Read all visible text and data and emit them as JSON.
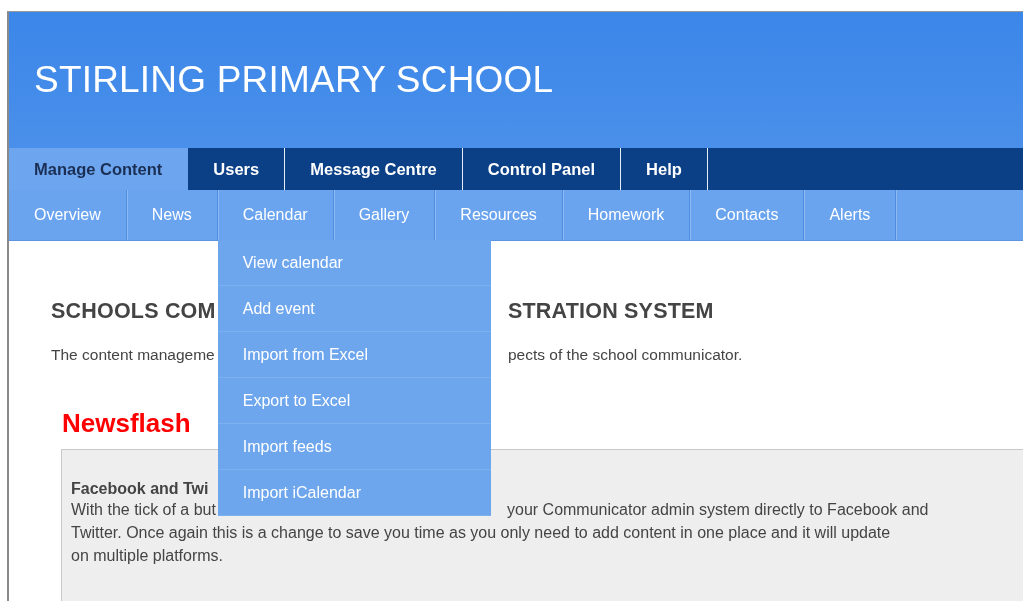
{
  "site_title": "STIRLING PRIMARY SCHOOL",
  "main_nav": [
    {
      "label": "Manage Content",
      "selected": true
    },
    {
      "label": "Users",
      "selected": false
    },
    {
      "label": "Message Centre",
      "selected": false
    },
    {
      "label": "Control Panel",
      "selected": false
    },
    {
      "label": "Help",
      "selected": false
    }
  ],
  "sub_nav": [
    {
      "label": "Overview"
    },
    {
      "label": "News"
    },
    {
      "label": "Calendar",
      "menu": [
        "View calendar",
        "Add event",
        "Import from Excel",
        "Export to Excel",
        "Import feeds",
        "Import iCalendar"
      ]
    },
    {
      "label": "Gallery"
    },
    {
      "label": "Resources"
    },
    {
      "label": "Homework"
    },
    {
      "label": "Contacts"
    },
    {
      "label": "Alerts"
    }
  ],
  "heading": {
    "left": "SCHOOLS COM",
    "right": "STRATION SYSTEM"
  },
  "intro": {
    "left": "The content manageme",
    "right": "pects of the school communicator."
  },
  "newsflash": {
    "title": "Newsflash",
    "item_title": "Facebook and Twi",
    "lines": [
      {
        "left": "With the tick of a but",
        "right": "your Communicator admin system directly to Facebook and"
      },
      {
        "text": "Twitter. Once again this is a change to save you time as you only need to add content in one place and it will update"
      },
      {
        "text": "on multiple platforms."
      }
    ]
  }
}
